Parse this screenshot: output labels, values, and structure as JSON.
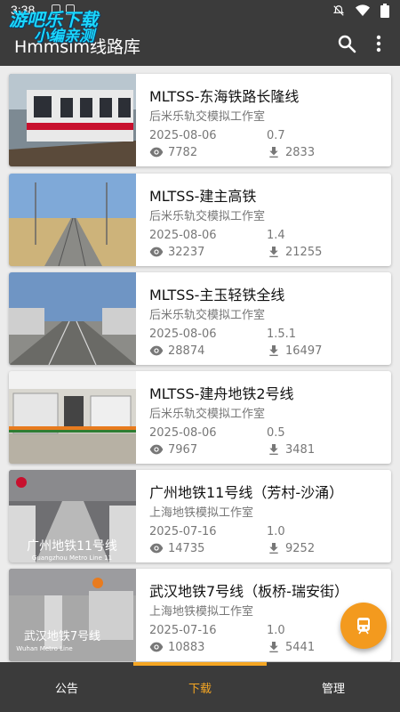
{
  "status_bar": {
    "time": "3:38"
  },
  "watermark": {
    "line1": "游吧乐下载",
    "line2": "小编亲测"
  },
  "app_bar": {
    "title": "Hmmsim线路库",
    "search_icon": "search-icon",
    "more_icon": "more-vert-icon"
  },
  "routes": [
    {
      "title": "MLTSS-东海铁路长隆线",
      "studio": "后米乐轨交模拟工作室",
      "date": "2025-08-06",
      "version": "0.7",
      "views": "7782",
      "downloads": "2833"
    },
    {
      "title": "MLTSS-建主高铁",
      "studio": "后米乐轨交模拟工作室",
      "date": "2025-08-06",
      "version": "1.4",
      "views": "32237",
      "downloads": "21255"
    },
    {
      "title": "MLTSS-主玉轻铁全线",
      "studio": "后米乐轨交模拟工作室",
      "date": "2025-08-06",
      "version": "1.5.1",
      "views": "28874",
      "downloads": "16497"
    },
    {
      "title": "MLTSS-建舟地铁2号线",
      "studio": "后米乐轨交模拟工作室",
      "date": "2025-08-06",
      "version": "0.5",
      "views": "7967",
      "downloads": "3481"
    },
    {
      "title": "广州地铁11号线（芳村-沙涌）",
      "studio": "上海地铁模拟工作室",
      "date": "2025-07-16",
      "version": "1.0",
      "views": "14735",
      "downloads": "9252",
      "thumb_text": "广州地铁11号线",
      "thumb_sub": "Guangzhou Metro Line 11"
    },
    {
      "title": "武汉地铁7号线（板桥-瑞安街）",
      "studio": "上海地铁模拟工作室",
      "date": "2025-07-16",
      "version": "1.0",
      "views": "10883",
      "downloads": "5441",
      "thumb_text": "武汉地铁7号线",
      "thumb_sub": "Wuhan Metro Line"
    }
  ],
  "bottom_nav": [
    {
      "label": "公告",
      "active": false
    },
    {
      "label": "下载",
      "active": true
    },
    {
      "label": "管理",
      "active": false
    }
  ],
  "colors": {
    "accent": "#f5a623",
    "fab": "#f39a1e",
    "bar": "#3b3b3b"
  },
  "fab_icon": "train-icon"
}
